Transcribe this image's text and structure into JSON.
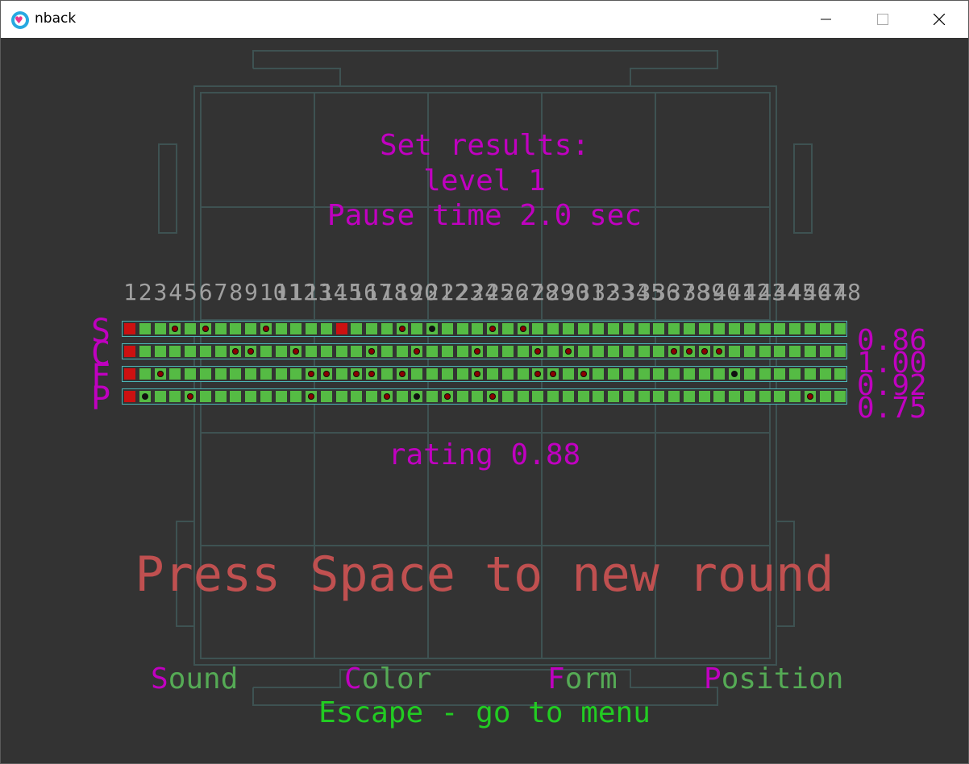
{
  "window": {
    "title": "nback",
    "icon": "heart-app-icon",
    "controls": [
      "minimize-icon",
      "maximize-icon",
      "close-icon"
    ]
  },
  "header": {
    "line1": "Set results:",
    "line2": "level 1",
    "line3": "Pause time 2.0 sec"
  },
  "trial_numbers": [
    "1",
    "2",
    "3",
    "4",
    "5",
    "6",
    "7",
    "8",
    "9",
    "10",
    "11",
    "12",
    "13",
    "14",
    "15",
    "16",
    "17",
    "18",
    "19",
    "20",
    "21",
    "22",
    "23",
    "24",
    "25",
    "26",
    "27",
    "28",
    "29",
    "30",
    "31",
    "32",
    "33",
    "34",
    "35",
    "36",
    "37",
    "38",
    "39",
    "40",
    "41",
    "42",
    "43",
    "44",
    "45",
    "46",
    "47",
    "48"
  ],
  "rows": [
    {
      "label": "S",
      "score": "0.86",
      "cells": [
        "red",
        "ok",
        "ok",
        "miss",
        "ok",
        "miss",
        "ok",
        "ok",
        "ok",
        "miss",
        "ok",
        "ok",
        "ok",
        "ok",
        "red",
        "ok",
        "ok",
        "ok",
        "miss",
        "ok",
        "hit",
        "ok",
        "ok",
        "ok",
        "miss",
        "ok",
        "miss",
        "ok",
        "ok",
        "ok",
        "ok",
        "ok",
        "ok",
        "ok",
        "ok",
        "ok",
        "ok",
        "ok",
        "ok",
        "ok",
        "ok",
        "ok",
        "ok",
        "ok",
        "ok",
        "ok",
        "ok",
        "ok"
      ]
    },
    {
      "label": "C",
      "score": "1.00",
      "cells": [
        "red",
        "ok",
        "ok",
        "ok",
        "ok",
        "ok",
        "ok",
        "miss",
        "miss",
        "ok",
        "ok",
        "miss",
        "ok",
        "ok",
        "ok",
        "ok",
        "miss",
        "ok",
        "ok",
        "miss",
        "ok",
        "ok",
        "ok",
        "miss",
        "ok",
        "ok",
        "ok",
        "miss",
        "ok",
        "miss",
        "ok",
        "ok",
        "ok",
        "ok",
        "ok",
        "ok",
        "miss",
        "miss",
        "miss",
        "miss",
        "ok",
        "ok",
        "ok",
        "ok",
        "ok",
        "ok",
        "ok",
        "ok"
      ]
    },
    {
      "label": "F",
      "score": "0.92",
      "cells": [
        "red",
        "ok",
        "miss",
        "ok",
        "ok",
        "ok",
        "ok",
        "ok",
        "ok",
        "ok",
        "ok",
        "ok",
        "miss",
        "miss",
        "ok",
        "miss",
        "miss",
        "ok",
        "miss",
        "ok",
        "ok",
        "ok",
        "ok",
        "miss",
        "ok",
        "ok",
        "ok",
        "miss",
        "miss",
        "ok",
        "miss",
        "ok",
        "ok",
        "ok",
        "ok",
        "ok",
        "ok",
        "ok",
        "ok",
        "ok",
        "hit",
        "ok",
        "ok",
        "ok",
        "ok",
        "ok",
        "ok",
        "ok"
      ]
    },
    {
      "label": "P",
      "score": "0.75",
      "cells": [
        "red",
        "hit",
        "ok",
        "ok",
        "miss",
        "ok",
        "ok",
        "ok",
        "ok",
        "ok",
        "ok",
        "ok",
        "miss",
        "ok",
        "ok",
        "ok",
        "ok",
        "miss",
        "ok",
        "hit",
        "ok",
        "miss",
        "ok",
        "ok",
        "miss",
        "ok",
        "ok",
        "ok",
        "ok",
        "ok",
        "ok",
        "ok",
        "ok",
        "ok",
        "ok",
        "ok",
        "ok",
        "ok",
        "ok",
        "ok",
        "ok",
        "ok",
        "ok",
        "ok",
        "ok",
        "miss",
        "ok",
        "ok"
      ]
    }
  ],
  "rating": "rating 0.88",
  "prompt": "Press Space to new round",
  "modalities": [
    {
      "key": "S",
      "rest": "ound"
    },
    {
      "key": "C",
      "rest": "olor"
    },
    {
      "key": "F",
      "rest": "orm"
    },
    {
      "key": "P",
      "rest": "osition"
    }
  ],
  "escape_hint": "Escape - go to menu",
  "colors": {
    "background": "#333333",
    "accent": "#c000c0",
    "cell_ok": "#55bb44",
    "cell_error": "#cc1111",
    "strip_border": "#4db8b8",
    "prompt": "#c05050",
    "escape": "#22cc22"
  }
}
